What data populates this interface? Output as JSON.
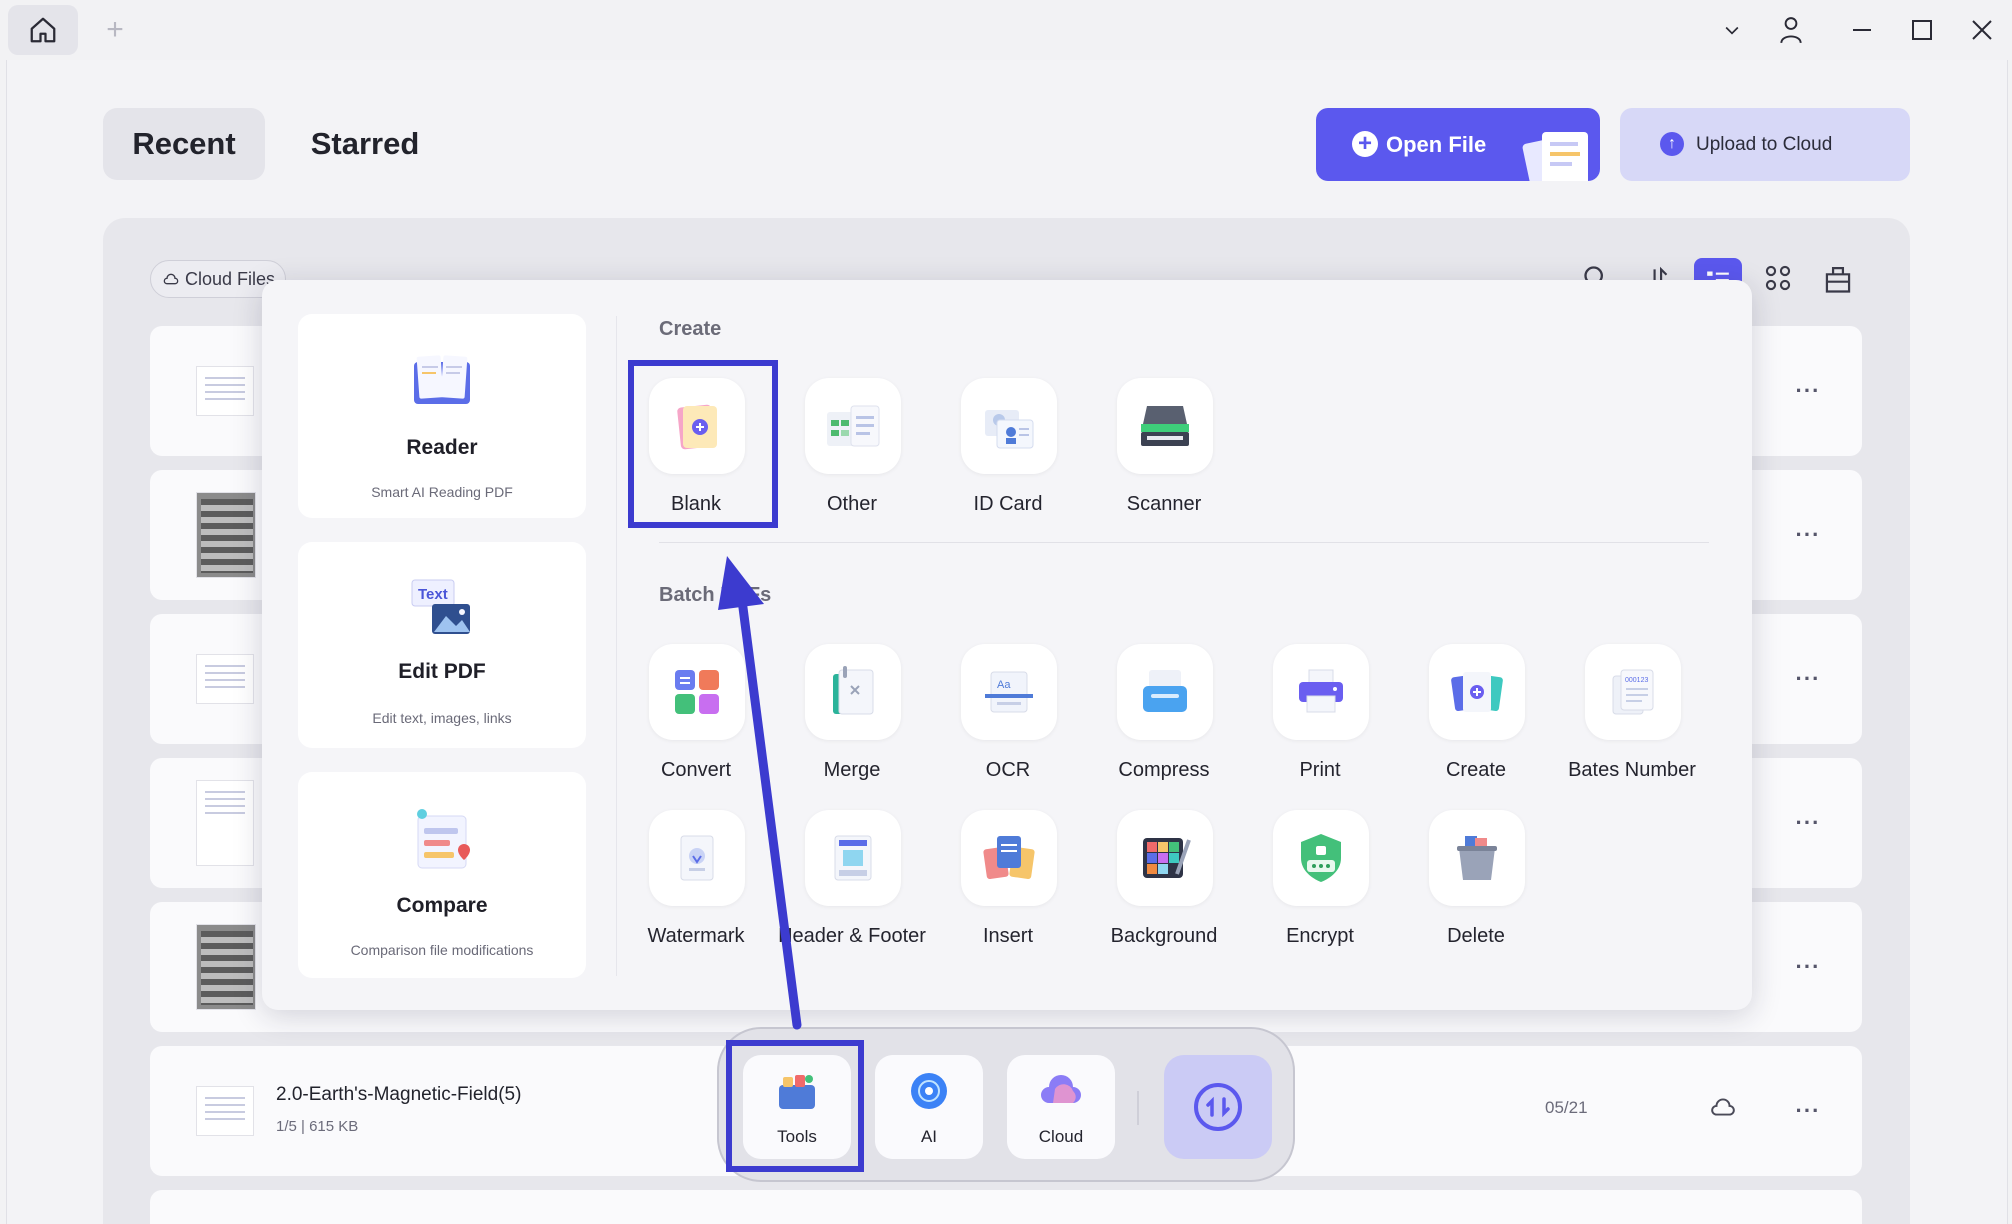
{
  "titlebar": {
    "icons": [
      "home-icon",
      "plus-icon",
      "chevron-down-icon",
      "user-icon",
      "minimize-icon",
      "maximize-icon",
      "close-icon"
    ]
  },
  "header": {
    "tabs": [
      {
        "label": "Recent"
      },
      {
        "label": "Starred"
      }
    ],
    "open_file_label": "Open File",
    "upload_label": "Upload to Cloud"
  },
  "filter": {
    "cloud_files_label": "Cloud Files"
  },
  "file_list": {
    "rows": [
      {
        "name": "2.0-Earth's-Magnetic-Field(5)",
        "meta": "1/5 | 615 KB",
        "date": "05/21"
      }
    ]
  },
  "tools_popup": {
    "side_cards": [
      {
        "title": "Reader",
        "subtitle": "Smart AI Reading PDF"
      },
      {
        "title": "Edit PDF",
        "subtitle": "Edit text, images, links"
      },
      {
        "title": "Compare",
        "subtitle": "Comparison file modifications"
      }
    ],
    "edit_icon_text": "Text",
    "create_section": {
      "title": "Create",
      "items": [
        "Blank",
        "Other",
        "ID Card",
        "Scanner"
      ]
    },
    "batch_section": {
      "title": "Batch PDFs",
      "items": [
        "Convert",
        "Merge",
        "OCR",
        "Compress",
        "Print",
        "Create",
        "Bates Number",
        "Watermark",
        "Header & Footer",
        "Insert",
        "Background",
        "Encrypt",
        "Delete"
      ]
    }
  },
  "dock": {
    "items": [
      {
        "label": "Tools"
      },
      {
        "label": "AI"
      },
      {
        "label": "Cloud"
      }
    ]
  },
  "colors": {
    "accent": "#5b58ee",
    "highlight_annotation": "#3c3bcf"
  }
}
